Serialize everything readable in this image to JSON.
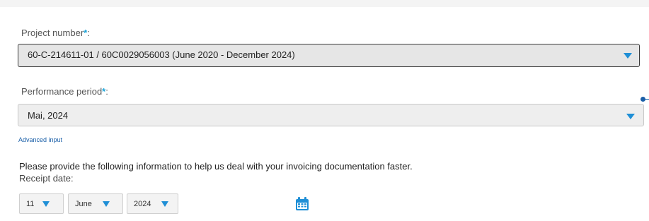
{
  "project": {
    "label": "Project number",
    "required_mark": "*",
    "label_suffix": ":",
    "value": "60-C-214611-01 / 60C0029056003 (June 2020 - December 2024)"
  },
  "performance": {
    "label": "Performance period",
    "required_mark": "*",
    "label_suffix": ":",
    "value": "Mai, 2024",
    "advanced_link": "Advanced input"
  },
  "info": {
    "text": "Please provide the following information to help us deal with your invoicing documentation faster."
  },
  "receipt": {
    "label": "Receipt date:",
    "day": "11",
    "month": "June",
    "year": "2024"
  },
  "colors": {
    "accent": "#1f8fd6",
    "required": "#1aa3d9",
    "link": "#1a5fa8"
  },
  "icons": {
    "dropdown": "triangle-down",
    "calendar": "calendar-icon"
  }
}
